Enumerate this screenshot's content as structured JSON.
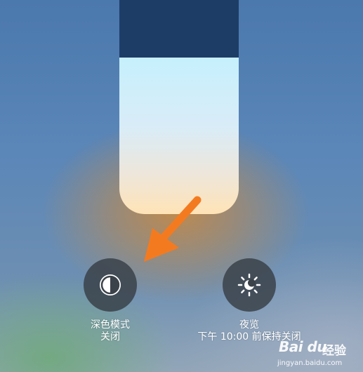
{
  "brightness": {
    "level_fraction": 0.73
  },
  "dark_mode": {
    "title": "深色模式",
    "status": "关闭",
    "icon": "dark-mode-icon"
  },
  "night_shift": {
    "title": "夜览",
    "status": "下午 10:00 前保持关闭",
    "icon": "sun-moon-icon"
  },
  "annotation": {
    "color": "#f47a20"
  },
  "watermark": {
    "logo": "Bai du",
    "brand": "经验",
    "url": "jingyan.baidu.com"
  }
}
